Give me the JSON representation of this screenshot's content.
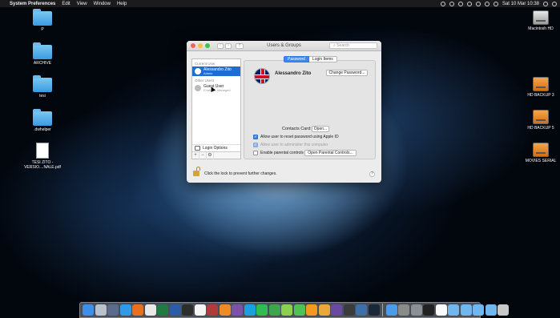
{
  "menubar": {
    "apple_glyph": "",
    "app_name": "System Preferences",
    "menus": [
      "Edit",
      "View",
      "Window",
      "Help"
    ],
    "clock": "Sat 10 Mar  10:38"
  },
  "desktop_left": [
    {
      "label": "P",
      "icon": "folder-icon",
      "kind": "folder"
    },
    {
      "label": "ARCHIVE",
      "icon": "folder-icon",
      "kind": "folder"
    },
    {
      "label": "tesi",
      "icon": "folder-icon",
      "kind": "folder"
    },
    {
      "label": ".dwhelper",
      "icon": "folder-icon",
      "kind": "folder"
    },
    {
      "label": "TESI ZITO - VERSIO....NALE.pdf",
      "icon": "pdf-icon",
      "kind": "pdf"
    }
  ],
  "desktop_right": [
    {
      "label": "Macintosh HD",
      "icon": "drive-icon",
      "kind": "drive"
    },
    {
      "label": "HD BACKUP 3",
      "icon": "external-drive-icon",
      "kind": "drive-orange"
    },
    {
      "label": "HD BACKUP 5",
      "icon": "external-drive-icon",
      "kind": "drive-orange"
    },
    {
      "label": "MOVIES SERIAL",
      "icon": "external-drive-icon",
      "kind": "drive-orange"
    }
  ],
  "window": {
    "title": "Users & Groups",
    "search_placeholder": "Search",
    "nav_back": "‹",
    "nav_forward": "›",
    "grid_glyph": "⠿",
    "sidebar": {
      "current_user_header": "Current User",
      "current_user": {
        "name": "Alessandro Zito",
        "role": "Admin"
      },
      "other_users_header": "Other Users",
      "other_users": [
        {
          "name": "Guest User",
          "role": "Enabled, Managed"
        }
      ],
      "login_options": "Login Options",
      "add": "+",
      "remove": "−",
      "gear": "⚙"
    },
    "tabs": [
      "Password",
      "Login Items"
    ],
    "selected_tab": "Password",
    "full_name": "Alessandro Zito",
    "change_password_button": "Change Password...",
    "contacts_card_label": "Contacts Card:",
    "open_button": "Open...",
    "options": [
      {
        "label": "Allow user to reset password using Apple ID",
        "checked": true,
        "enabled": true
      },
      {
        "label": "Allow user to administer this computer",
        "checked": true,
        "enabled": false
      },
      {
        "label": "Enable parental controls",
        "checked": false,
        "enabled": true
      }
    ],
    "parental_controls_button": "Open Parental Controls...",
    "lock_text": "Click the lock to prevent further changes.",
    "help": "?"
  },
  "dock": {
    "apps": [
      {
        "name": "finder-icon",
        "color": "#3d8fe8"
      },
      {
        "name": "launchpad-icon",
        "color": "#b9c2cc"
      },
      {
        "name": "mission-control-icon",
        "color": "#5a6b8c"
      },
      {
        "name": "safari-icon",
        "color": "#2f9be8"
      },
      {
        "name": "firefox-icon",
        "color": "#e8701e"
      },
      {
        "name": "chrome-icon",
        "color": "#e9e9e9"
      },
      {
        "name": "excel-icon",
        "color": "#1f7a43"
      },
      {
        "name": "word-icon",
        "color": "#2b5ca8"
      },
      {
        "name": "activity-monitor-icon",
        "color": "#2d2d2d"
      },
      {
        "name": "calendar-icon",
        "color": "#f5f5f5"
      },
      {
        "name": "photo-booth-icon",
        "color": "#b33a3a"
      },
      {
        "name": "vlc-icon",
        "color": "#f08a24"
      },
      {
        "name": "textwrangler-icon",
        "color": "#7b52a8"
      },
      {
        "name": "skype-icon",
        "color": "#1a9fe0"
      },
      {
        "name": "whatsapp-icon",
        "color": "#2fbd4f"
      },
      {
        "name": "facetime-icon",
        "color": "#3ba64c"
      },
      {
        "name": "music-icon",
        "color": "#8ad14e"
      },
      {
        "name": "messages-icon",
        "color": "#4fc256"
      },
      {
        "name": "ibooks-icon",
        "color": "#f29a1d"
      },
      {
        "name": "pages-icon",
        "color": "#e9a93a"
      },
      {
        "name": "imovie-icon",
        "color": "#6a4aa0"
      },
      {
        "name": "final-cut-icon",
        "color": "#3b3b3b"
      },
      {
        "name": "quicktime-icon",
        "color": "#3f6fa8"
      },
      {
        "name": "steam-icon",
        "color": "#1b2838"
      }
    ],
    "tail": [
      {
        "name": "preview-icon",
        "color": "#4c9be8"
      },
      {
        "name": "image-capture-icon",
        "color": "#8a8a8a"
      },
      {
        "name": "system-preferences-icon",
        "color": "#8b8f96"
      },
      {
        "name": "terminal-icon",
        "color": "#222222"
      },
      {
        "name": "document-icon",
        "color": "#fafafa"
      },
      {
        "name": "downloads-folder-icon",
        "color": "#6fb7ee"
      },
      {
        "name": "documents-folder-icon",
        "color": "#6fb7ee"
      },
      {
        "name": "applications-folder-icon",
        "color": "#6fb7ee"
      },
      {
        "name": "desktop-folder-icon",
        "color": "#6fb7ee"
      },
      {
        "name": "trash-icon",
        "color": "#c8c8c8"
      }
    ]
  }
}
